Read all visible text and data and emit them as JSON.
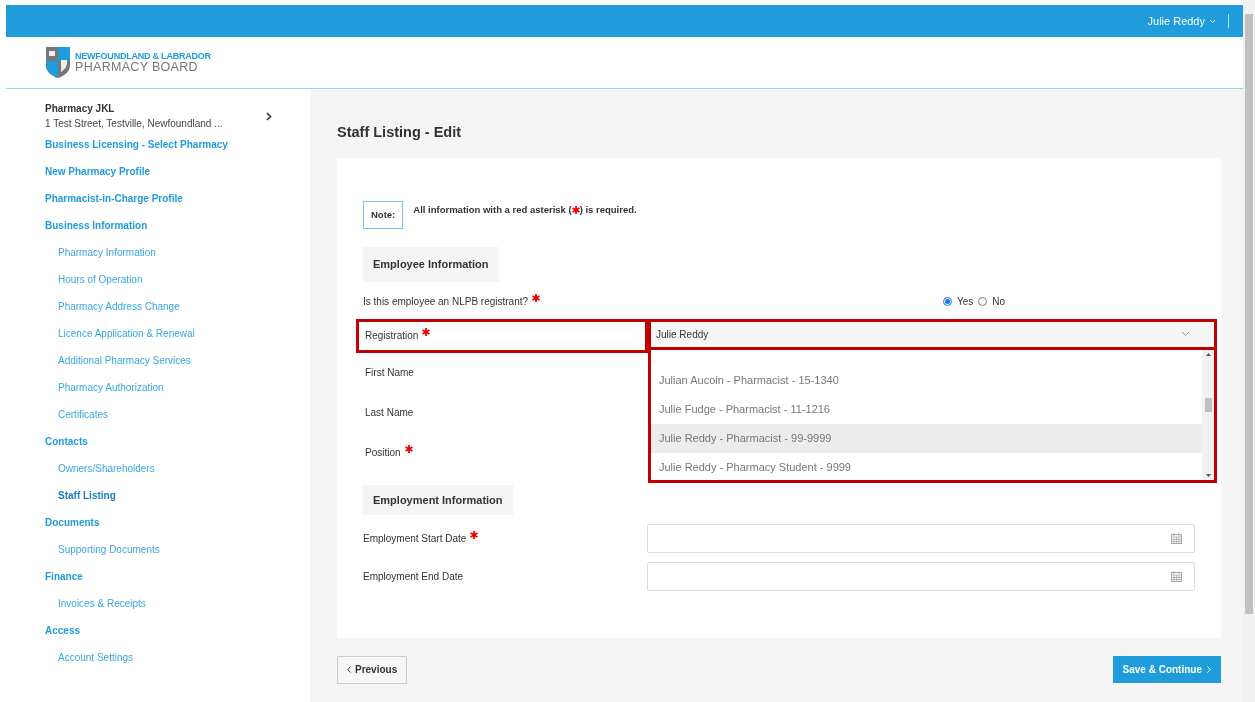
{
  "header": {
    "user": "Julie Reddy"
  },
  "logo": {
    "line1": "NEWFOUNDLAND & LABRADOR",
    "line2": "PHARMACY BOARD"
  },
  "pharmacy": {
    "name": "Pharmacy JKL",
    "address": "1 Test Street, Testville, Newfoundland ..."
  },
  "sidebar": {
    "items": [
      {
        "label": "Business Licensing - Select Pharmacy",
        "kind": "section",
        "selected": false
      },
      {
        "label": "New Pharmacy Profile",
        "kind": "section",
        "selected": false
      },
      {
        "label": "Pharmacist-in-Charge Profile",
        "kind": "section",
        "selected": false
      },
      {
        "label": "Business Information",
        "kind": "section",
        "selected": false
      },
      {
        "label": "Pharmacy Information",
        "kind": "sub",
        "selected": false
      },
      {
        "label": "Hours of Operation",
        "kind": "sub",
        "selected": false
      },
      {
        "label": "Pharmacy Address Change",
        "kind": "sub",
        "selected": false
      },
      {
        "label": "Licence Application & Renewal",
        "kind": "sub",
        "selected": false
      },
      {
        "label": "Additional Pharmacy Services",
        "kind": "sub",
        "selected": false
      },
      {
        "label": "Pharmacy Authorization",
        "kind": "sub",
        "selected": false
      },
      {
        "label": "Certificates",
        "kind": "sub",
        "selected": false
      },
      {
        "label": "Contacts",
        "kind": "section",
        "selected": false
      },
      {
        "label": "Owners/Shareholders",
        "kind": "sub",
        "selected": false
      },
      {
        "label": "Staff Listing",
        "kind": "sub",
        "selected": true
      },
      {
        "label": "Documents",
        "kind": "section",
        "selected": false
      },
      {
        "label": "Supporting Documents",
        "kind": "sub",
        "selected": false
      },
      {
        "label": "Finance",
        "kind": "section",
        "selected": false
      },
      {
        "label": "Invoices & Receipts",
        "kind": "sub",
        "selected": false
      },
      {
        "label": "Access",
        "kind": "section",
        "selected": false
      },
      {
        "label": "Account Settings",
        "kind": "sub",
        "selected": false
      }
    ]
  },
  "page_title": "Staff Listing - Edit",
  "note": {
    "label": "Note:",
    "before": "All information with a red asterisk (",
    "after": ") is required."
  },
  "employee_section": "Employee Information",
  "registrant": {
    "label": "Is this employee an NLPB registrant?",
    "required": true,
    "options": [
      {
        "label": "Yes",
        "selected": true
      },
      {
        "label": "No",
        "selected": false
      }
    ]
  },
  "registration": {
    "label": "Registration",
    "required": true,
    "value": "Julie Reddy",
    "highlighted": true,
    "options": [
      {
        "label": "Julian Aucoin - Pharmacist - 15-1340",
        "selected": false
      },
      {
        "label": "Julie Fudge - Pharmacist - 11-1216",
        "selected": false
      },
      {
        "label": "Julie Reddy - Pharmacist - 99-9999",
        "selected": true
      },
      {
        "label": "Julie Reddy - Pharmacy Student - 9999",
        "selected": false
      }
    ]
  },
  "employee_fields": [
    {
      "label": "First Name",
      "required": false
    },
    {
      "label": "Last Name",
      "required": false
    },
    {
      "label": "Position",
      "required": true
    }
  ],
  "employment_section": "Employment Information",
  "date_fields": [
    {
      "label": "Employment Start Date",
      "required": true
    },
    {
      "label": "Employment End Date",
      "required": false
    }
  ],
  "buttons": {
    "previous": "Previous",
    "save": "Save & Continue"
  }
}
